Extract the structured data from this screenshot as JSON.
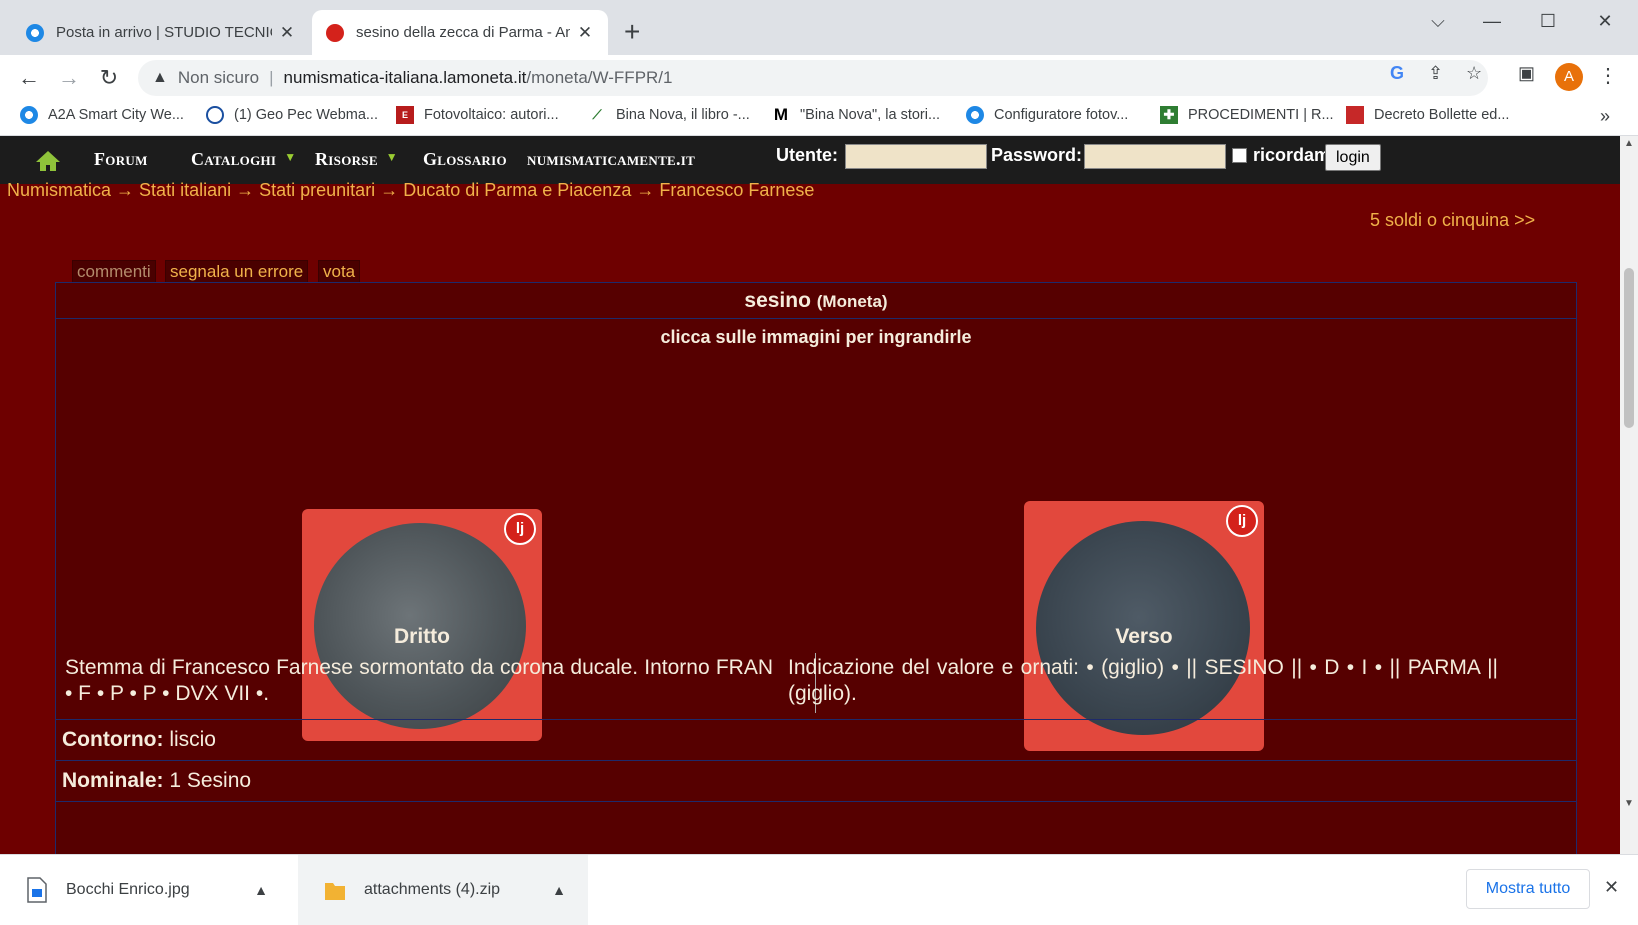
{
  "tabs": [
    {
      "title": "Posta in arrivo | STUDIO TECNICO",
      "close": "✕"
    },
    {
      "title": "sesino della zecca di Parma - Ant",
      "close": "✕"
    }
  ],
  "new_tab": "+",
  "window_controls": {
    "tab_search": "⌵",
    "minimize": "—",
    "maximize": "☐",
    "close": "✕"
  },
  "address": {
    "warning": "Non sicuro",
    "host": "numismatica-italiana.lamoneta.it",
    "path": "/moneta/W-FFPR/1",
    "avatar_letter": "A"
  },
  "bookmarks": [
    "A2A Smart City We...",
    "(1) Geo Pec Webma...",
    "Fotovoltaico: autori...",
    "Bina Nova, il libro -...",
    "\"Bina Nova\", la stori...",
    "Configuratore fotov...",
    "PROCEDIMENTI | R...",
    "Decreto Bollette ed..."
  ],
  "bookmarks_overflow": "»",
  "nav": {
    "items": [
      "Forum",
      "Cataloghi",
      "Risorse",
      "Glossario",
      "numismaticamente.it"
    ],
    "user_label": "Utente:",
    "password_label": "Password:",
    "remember_label": "ricordami",
    "login_button": "login"
  },
  "breadcrumb": [
    "Numismatica",
    "Stati italiani",
    "Stati preunitari",
    "Ducato di Parma e Piacenza",
    "Francesco Farnese"
  ],
  "breadcrumb_sep": " → ",
  "next_link": "5 soldi o cinquina >>",
  "actions": [
    "commenti",
    "segnala un errore",
    "vota"
  ],
  "coin": {
    "name": "sesino",
    "type": "(Moneta)",
    "hint": "clicca sulle immagini per ingrandirle",
    "obverse_label": "Dritto",
    "reverse_label": "Verso",
    "obverse_desc": "Stemma di Francesco Farnese sormontato da corona ducale. Intorno FRAN • F • P • P • DVX VII •.",
    "reverse_desc": "Indicazione del valore e ornati: • (giglio) • || SESINO || • D • I • || PARMA || (giglio).",
    "fields": [
      {
        "label": "Contorno:",
        "value": "liscio"
      },
      {
        "label": "Nominale:",
        "value": "1 Sesino"
      }
    ]
  },
  "downloads": [
    {
      "name": "Bocchi Enrico.jpg"
    },
    {
      "name": "attachments (4).zip"
    }
  ],
  "show_all": "Mostra tutto",
  "colors": {
    "page_bg": "#6e0000",
    "box_bg": "#560000",
    "link": "#f0b24a",
    "navbar": "#1c1c1c"
  }
}
